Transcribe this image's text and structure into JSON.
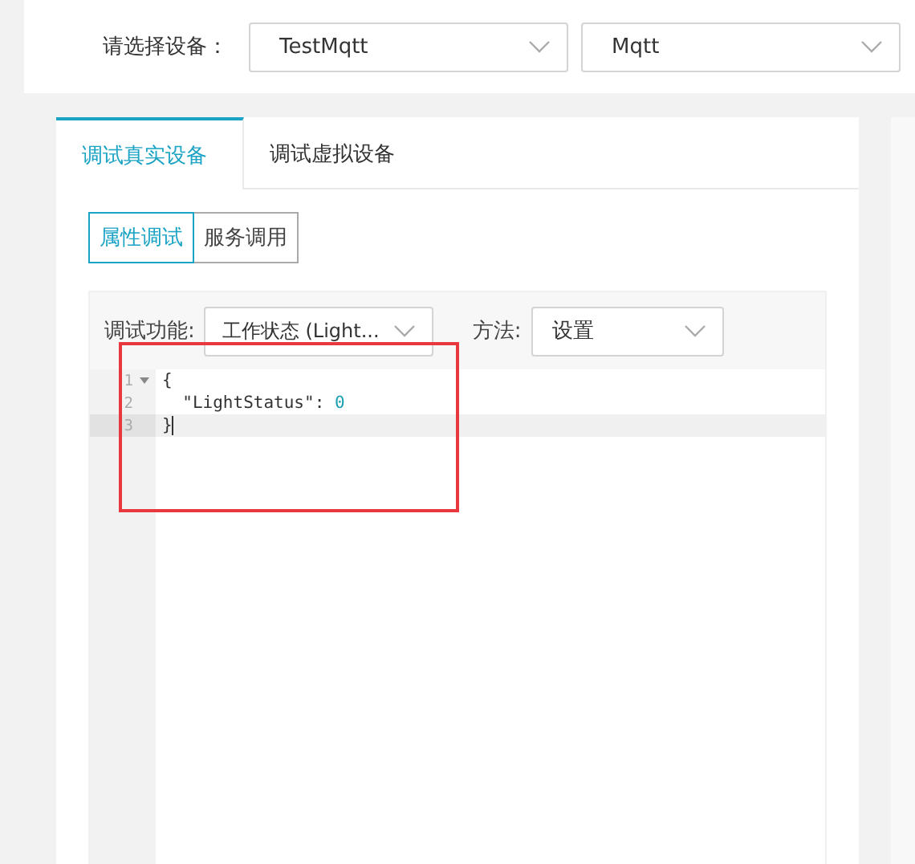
{
  "device_picker": {
    "label": "请选择设备：",
    "selects": [
      {
        "value": "TestMqtt"
      },
      {
        "value": "Mqtt"
      }
    ]
  },
  "tabs": [
    {
      "label": "调试真实设备",
      "selected": true
    },
    {
      "label": "调试虚拟设备",
      "selected": false
    }
  ],
  "mode_buttons": [
    {
      "label": "属性调试",
      "selected": true
    },
    {
      "label": "服务调用",
      "selected": false
    }
  ],
  "debug_form": {
    "function_label": "调试功能:",
    "function_value": "工作状态 (Light...",
    "method_label": "方法:",
    "method_value": "设置"
  },
  "editor": {
    "lines": [
      {
        "number": "1",
        "kind": "text",
        "text": "{",
        "foldable": true,
        "active": false
      },
      {
        "number": "2",
        "kind": "pair",
        "key": "\"LightStatus\": ",
        "value": "0",
        "foldable": false,
        "active": false
      },
      {
        "number": "3",
        "kind": "text",
        "text": "}",
        "foldable": false,
        "active": true
      }
    ]
  }
}
